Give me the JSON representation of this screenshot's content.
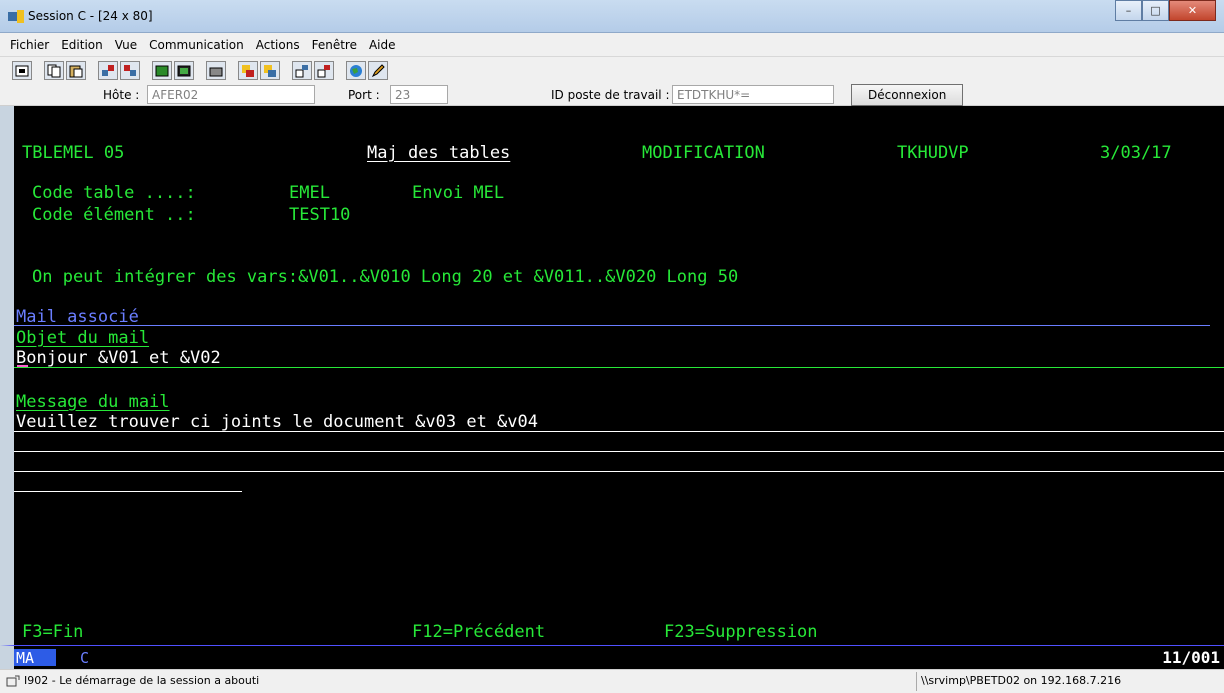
{
  "window": {
    "title": "Session C - [24 x 80]",
    "minimize": "–",
    "maximize": "□",
    "close": "✕"
  },
  "menu": [
    "Fichier",
    "Edition",
    "Vue",
    "Communication",
    "Actions",
    "Fenêtre",
    "Aide"
  ],
  "toolbar": {
    "host_label": "Hôte :",
    "host_value": "AFER02",
    "port_label": "Port :",
    "port_value": "23",
    "ws_label": "ID poste de travail :",
    "ws_value": "ETDTKHU*=",
    "disconnect": "Déconnexion"
  },
  "screen": {
    "program": "TBLEMEL 05",
    "heading": "Maj des tables",
    "mode": "MODIFICATION",
    "user": "TKHUDVP",
    "date": "3/03/17",
    "code_table_label": "Code table ....:",
    "code_table_value": "EMEL",
    "code_table_desc": "Envoi MEL",
    "code_element_label": "Code élément ..:",
    "code_element_value": "TEST10",
    "info": "On peut intégrer des vars:&V01..&V010 Long 20 et &V011..&V020 Long 50",
    "mail_assoc": "Mail associé",
    "subject_label": "Objet du mail",
    "subject_value": "Bonjour &V01 et &V02",
    "message_label": "Message du mail",
    "message_line1": "Veuillez trouver ci joints le document &v03 et &v04",
    "f3": "F3=Fin",
    "f12": "F12=Précédent",
    "f23": "F23=Suppression"
  },
  "oia": {
    "mode": "MA",
    "indicator": "C",
    "cursor_pos": "11/001"
  },
  "status": {
    "message": "I902 - Le démarrage de la session a abouti",
    "printer": "\\\\srvimp\\PBETD02 on 192.168.7.216"
  }
}
